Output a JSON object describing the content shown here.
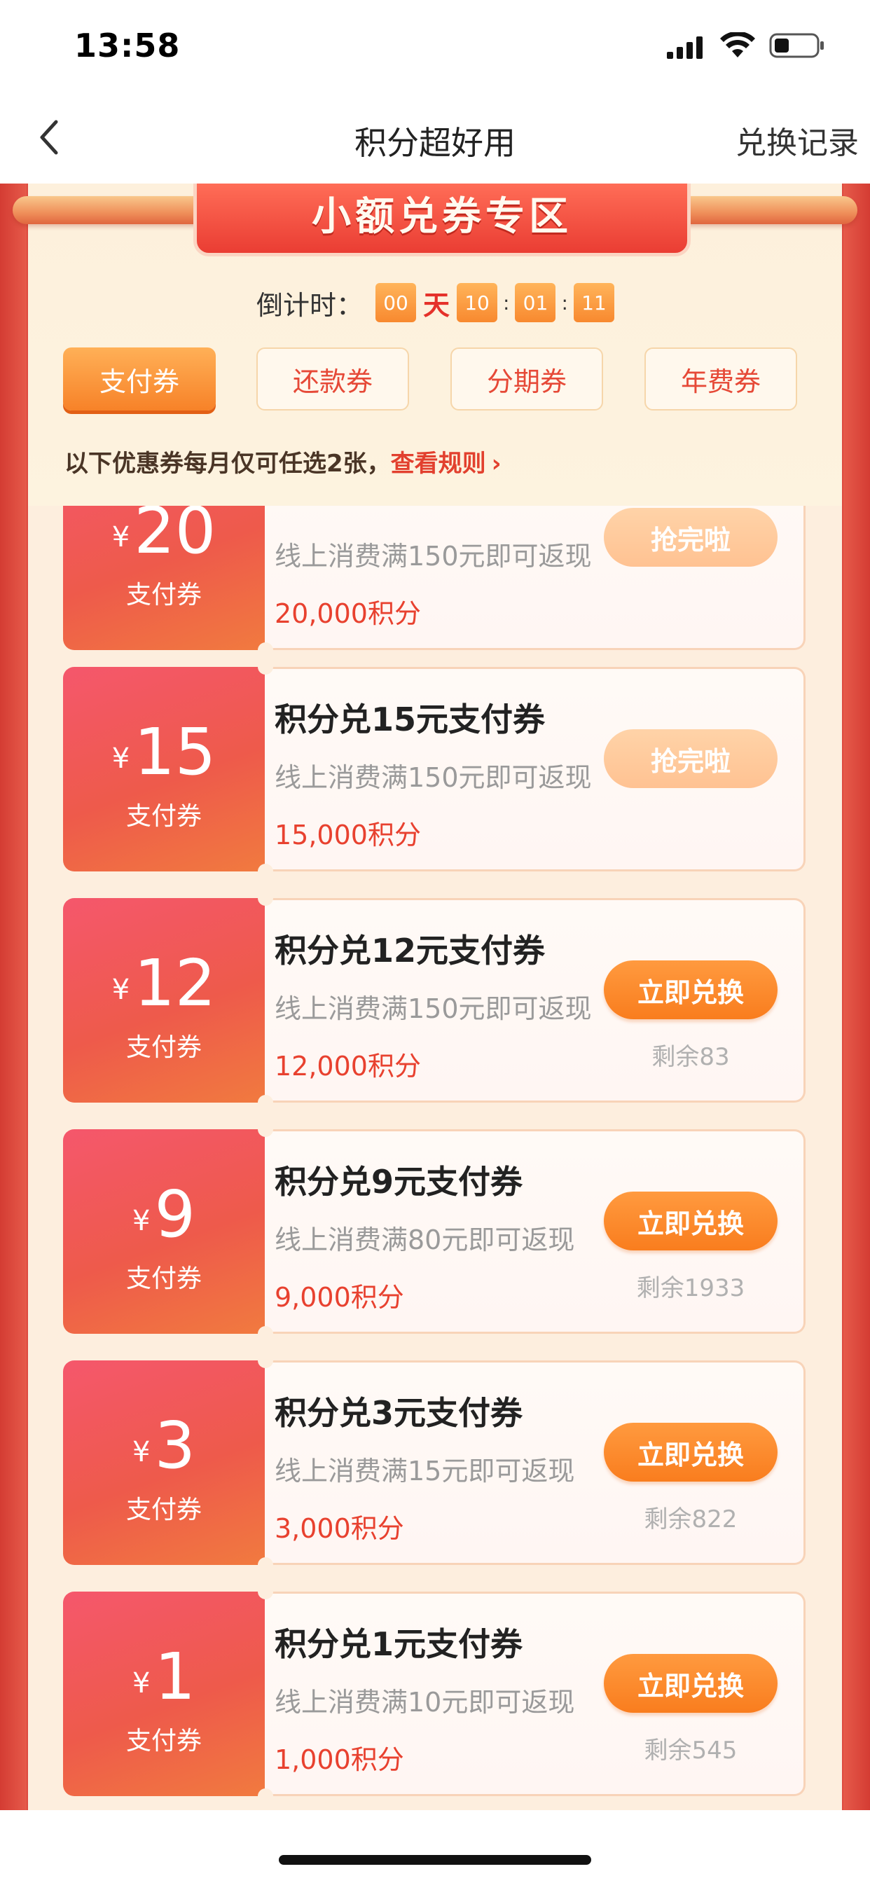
{
  "status_bar": {
    "time": "13:58",
    "icons": [
      "signal-icon",
      "wifi-icon",
      "battery-icon"
    ]
  },
  "nav": {
    "back_icon": "chevron-left-icon",
    "title": "积分超好用",
    "records": "兑换记录"
  },
  "banner": {
    "title": "小额兑券专区"
  },
  "countdown": {
    "label": "倒计时：",
    "days": "00",
    "day_unit": "天",
    "hours": "10",
    "minutes": "01",
    "seconds": "11",
    "sep1": ":",
    "sep2": ":"
  },
  "tabs": [
    {
      "label": "支付券",
      "active": true
    },
    {
      "label": "还款券",
      "active": false
    },
    {
      "label": "分期券",
      "active": false
    },
    {
      "label": "年费券",
      "active": false
    }
  ],
  "notice": {
    "text": "以下优惠券每月仅可任选2张，",
    "rule_link": "查看规则",
    "arrow": "›"
  },
  "coupons": [
    {
      "yen": "¥",
      "amount": "20",
      "type": "支付券",
      "title": "",
      "desc": "线上消费满150元即可返现",
      "points": "20,000积分",
      "button": "抢完啦",
      "sold_out": true,
      "remain": ""
    },
    {
      "yen": "¥",
      "amount": "15",
      "type": "支付券",
      "title": "积分兑15元支付券",
      "desc": "线上消费满150元即可返现",
      "points": "15,000积分",
      "button": "抢完啦",
      "sold_out": true,
      "remain": ""
    },
    {
      "yen": "¥",
      "amount": "12",
      "type": "支付券",
      "title": "积分兑12元支付券",
      "desc": "线上消费满150元即可返现",
      "points": "12,000积分",
      "button": "立即兑换",
      "sold_out": false,
      "remain": "剩余83"
    },
    {
      "yen": "¥",
      "amount": "9",
      "type": "支付券",
      "title": "积分兑9元支付券",
      "desc": "线上消费满80元即可返现",
      "points": "9,000积分",
      "button": "立即兑换",
      "sold_out": false,
      "remain": "剩余1933"
    },
    {
      "yen": "¥",
      "amount": "3",
      "type": "支付券",
      "title": "积分兑3元支付券",
      "desc": "线上消费满15元即可返现",
      "points": "3,000积分",
      "button": "立即兑换",
      "sold_out": false,
      "remain": "剩余822"
    },
    {
      "yen": "¥",
      "amount": "1",
      "type": "支付券",
      "title": "积分兑1元支付券",
      "desc": "线上消费满10元即可返现",
      "points": "1,000积分",
      "button": "立即兑换",
      "sold_out": false,
      "remain": "剩余545"
    }
  ],
  "colors": {
    "accent_red": "#e8412f",
    "button_orange": "#f97d1e",
    "sold_out_orange": "#ffc292",
    "panel_cream": "#fdeede",
    "frame_red": "#dd4b40"
  }
}
